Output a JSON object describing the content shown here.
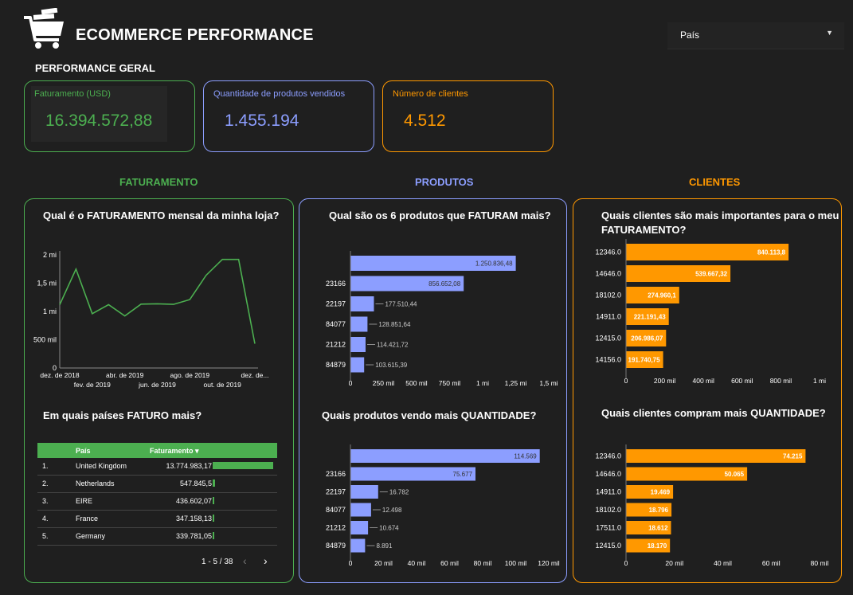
{
  "header": {
    "title": "ECOMMERCE PERFORMANCE",
    "filter_label": "País"
  },
  "overview": {
    "label": "PERFORMANCE GERAL",
    "kpis": [
      {
        "label": "Faturamento (USD)",
        "value": "16.394.572,88"
      },
      {
        "label": "Quantidade de produtos vendidos",
        "value": "1.455.194"
      },
      {
        "label": "Número de clientes",
        "value": "4.512"
      }
    ]
  },
  "sections": {
    "revenue": "FATURAMENTO",
    "products": "PRODUTOS",
    "clients": "CLIENTES"
  },
  "colors": {
    "green": "#4caf50",
    "blue": "#8c9eff",
    "orange": "#ff9800",
    "background": "#1f1f1f"
  },
  "revenue_chart": {
    "title": "Qual é o FATURAMENTO mensal da minha loja?",
    "y_ticks": [
      "0",
      "500 mil",
      "1 mi",
      "1,5 mi",
      "2 mi"
    ],
    "x_ticks_top": [
      "dez. de 2018",
      "abr. de 2019",
      "ago. de 2019",
      "dez. de..."
    ],
    "x_ticks_bottom": [
      "fev. de 2019",
      "jun. de 2019",
      "out. de 2019"
    ]
  },
  "country_table": {
    "title": "Em quais países FATURO mais?",
    "col_country": "País",
    "col_revenue": "Faturamento ▾",
    "rows": [
      {
        "rank": "1.",
        "country": "United Kingdom",
        "revenue": "13.774.983,17",
        "value": 13774983.17
      },
      {
        "rank": "2.",
        "country": "Netherlands",
        "revenue": "547.845,5",
        "value": 547845.5
      },
      {
        "rank": "3.",
        "country": "EIRE",
        "revenue": "436.602,07",
        "value": 436602.07
      },
      {
        "rank": "4.",
        "country": "France",
        "revenue": "347.158,13",
        "value": 347158.13
      },
      {
        "rank": "5.",
        "country": "Germany",
        "revenue": "339.781,05",
        "value": 339781.05
      }
    ],
    "pagination": "1 - 5 / 38"
  },
  "chart_data": [
    {
      "type": "line",
      "title": "Qual é o FATURAMENTO mensal da minha loja?",
      "x": [
        "dez. de 2018",
        "jan. de 2019",
        "fev. de 2019",
        "mar. de 2019",
        "abr. de 2019",
        "mai. de 2019",
        "jun. de 2019",
        "jul. de 2019",
        "ago. de 2019",
        "set. de 2019",
        "out. de 2019",
        "nov. de 2019",
        "dez. de 2019"
      ],
      "values": [
        1120000,
        1750000,
        960000,
        1120000,
        920000,
        1130000,
        1135000,
        1125000,
        1210000,
        1640000,
        1920000,
        1920000,
        430000
      ],
      "ylim": [
        0,
        2000000
      ],
      "color": "#4caf50"
    },
    {
      "type": "bar",
      "title": "Qual são os 6 produtos que FATURAM mais?",
      "categories": [
        "",
        "23166",
        "22197",
        "84077",
        "21212",
        "84879"
      ],
      "values": [
        1250836.48,
        856652.08,
        177510.44,
        128851.64,
        114421.72,
        103615.39
      ],
      "labels": [
        "1.250.836,48",
        "856.652,08",
        "177.510,44",
        "128.851,64",
        "114.421,72",
        "103.615,39"
      ],
      "x_ticks": [
        "0",
        "250 mil",
        "500 mil",
        "750 mil",
        "1 mi",
        "1,25 mi",
        "1,5 mi"
      ],
      "xlim": [
        0,
        1500000
      ],
      "color": "#8c9eff"
    },
    {
      "type": "bar",
      "title": "Quais produtos vendo mais QUANTIDADE?",
      "categories": [
        "",
        "23166",
        "22197",
        "84077",
        "21212",
        "84879"
      ],
      "values": [
        114569,
        75677,
        16782,
        12498,
        10674,
        8891
      ],
      "labels": [
        "114.569",
        "75.677",
        "16.782",
        "12.498",
        "10.674",
        "8.891"
      ],
      "x_ticks": [
        "0",
        "20 mil",
        "40 mil",
        "60 mil",
        "80 mil",
        "100 mil",
        "120 mil"
      ],
      "xlim": [
        0,
        120000
      ],
      "color": "#8c9eff"
    },
    {
      "type": "bar",
      "title": "Quais clientes são mais importantes para o meu FATURAMENTO?",
      "categories": [
        "12346.0",
        "14646.0",
        "18102.0",
        "14911.0",
        "12415.0",
        "14156.0"
      ],
      "values": [
        840113.8,
        539667.32,
        274960.1,
        221191.43,
        206986.07,
        191740.75
      ],
      "labels": [
        "840.113,8",
        "539.667,32",
        "274.960,1",
        "221.191,43",
        "206.986,07",
        "191.740,75"
      ],
      "x_ticks": [
        "0",
        "200 mil",
        "400 mil",
        "600 mil",
        "800 mil",
        "1 mi"
      ],
      "xlim": [
        0,
        1000000
      ],
      "color": "#ff9800"
    },
    {
      "type": "bar",
      "title": "Quais clientes compram mais QUANTIDADE?",
      "categories": [
        "12346.0",
        "14646.0",
        "14911.0",
        "18102.0",
        "17511.0",
        "12415.0"
      ],
      "values": [
        74215,
        50065,
        19469,
        18796,
        18612,
        18170
      ],
      "labels": [
        "74.215",
        "50.065",
        "19.469",
        "18.796",
        "18.612",
        "18.170"
      ],
      "x_ticks": [
        "0",
        "20 mil",
        "40 mil",
        "60 mil",
        "80 mil"
      ],
      "xlim": [
        0,
        80000
      ],
      "color": "#ff9800"
    }
  ]
}
